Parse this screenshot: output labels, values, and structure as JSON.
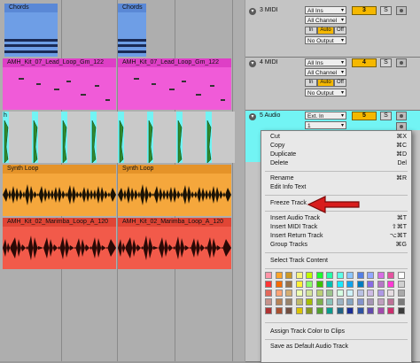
{
  "arrangement": {
    "chords_clip_label": "Chords",
    "lead_clip_label": "AMH_Kit_07_Lead_Loop_Gm_122",
    "audio_clip_label": "h",
    "synth_clip_label": "Synth Loop",
    "marimba_clip_label": "AMH_Kit_02_Marimba_Loop_A_120"
  },
  "tracks": [
    {
      "name": "3 MIDI",
      "input_type": "All Ins",
      "input_channel": "All Channel",
      "monitor": [
        "In",
        "Auto",
        "Off"
      ],
      "output": "No Output",
      "number": "3",
      "solo": "S",
      "color": "#6e9ee6"
    },
    {
      "name": "4 MIDI",
      "input_type": "All Ins",
      "input_channel": "All Channel",
      "monitor": [
        "In",
        "Auto",
        "Off"
      ],
      "output": "No Output",
      "number": "4",
      "solo": "S",
      "color": "#f05bd8"
    },
    {
      "name": "5 Audio",
      "input_type": "Ext. In",
      "input_channel": "1",
      "number": "5",
      "solo": "S",
      "color": "#72f4f4"
    }
  ],
  "context_menu": {
    "items": [
      {
        "label": "Cut",
        "shortcut": "⌘X"
      },
      {
        "label": "Copy",
        "shortcut": "⌘C"
      },
      {
        "label": "Duplicate",
        "shortcut": "⌘D"
      },
      {
        "label": "Delete",
        "shortcut": "Del"
      },
      {
        "label": "Rename",
        "shortcut": "⌘R"
      },
      {
        "label": "Edit Info Text",
        "shortcut": ""
      },
      {
        "label": "Freeze Track",
        "shortcut": ""
      },
      {
        "label": "Insert Audio Track",
        "shortcut": "⌘T"
      },
      {
        "label": "Insert MIDI Track",
        "shortcut": "⇧⌘T"
      },
      {
        "label": "Insert Return Track",
        "shortcut": "⌥⌘T"
      },
      {
        "label": "Group Tracks",
        "shortcut": "⌘G"
      },
      {
        "label": "Select Track Content",
        "shortcut": ""
      },
      {
        "label": "Assign Track Color to Clips",
        "shortcut": ""
      },
      {
        "label": "Save as Default Audio Track",
        "shortcut": ""
      }
    ],
    "palette": [
      "#ff94a6",
      "#ffa529",
      "#cc9927",
      "#f7f47c",
      "#bffb00",
      "#1aff2f",
      "#25ffa8",
      "#5cffe8",
      "#8bc5ff",
      "#5480e4",
      "#92a7ff",
      "#d86ce4",
      "#e553a0",
      "#ffffff",
      "#ff3636",
      "#f66c03",
      "#99724b",
      "#fff034",
      "#87ff67",
      "#3dc300",
      "#00bfaf",
      "#19e9ff",
      "#10a4ee",
      "#007dc0",
      "#886ce4",
      "#b677c6",
      "#ff39d4",
      "#d0d0d0",
      "#e2675a",
      "#ffa374",
      "#d3ad71",
      "#edffae",
      "#d2e498",
      "#bad074",
      "#9bc48d",
      "#d4fde1",
      "#cdf1f8",
      "#b9c1e3",
      "#cdbbe4",
      "#ae98e5",
      "#e5dce1",
      "#a9a9a9",
      "#c6928b",
      "#b78256",
      "#99836a",
      "#bfba69",
      "#a6be00",
      "#7db04d",
      "#88c2ba",
      "#9bb3c4",
      "#85a5c2",
      "#8393cc",
      "#a595b5",
      "#bf9fbe",
      "#bc7196",
      "#7b7b7b",
      "#af3333",
      "#a95131",
      "#724f41",
      "#dbc300",
      "#85961f",
      "#539f31",
      "#0a9c8e",
      "#236384",
      "#1a2f96",
      "#2f52a2",
      "#624bad",
      "#a34bad",
      "#cc2e6e",
      "#3c3c3c"
    ]
  },
  "colors": {
    "chords": "#6e9ee6",
    "lead": "#f05bd8",
    "audio": "#72f4f4",
    "synth": "#f5a73c",
    "marimba": "#f25a4a",
    "arrow": "#d81c1c",
    "track_number": "#f5b800"
  }
}
